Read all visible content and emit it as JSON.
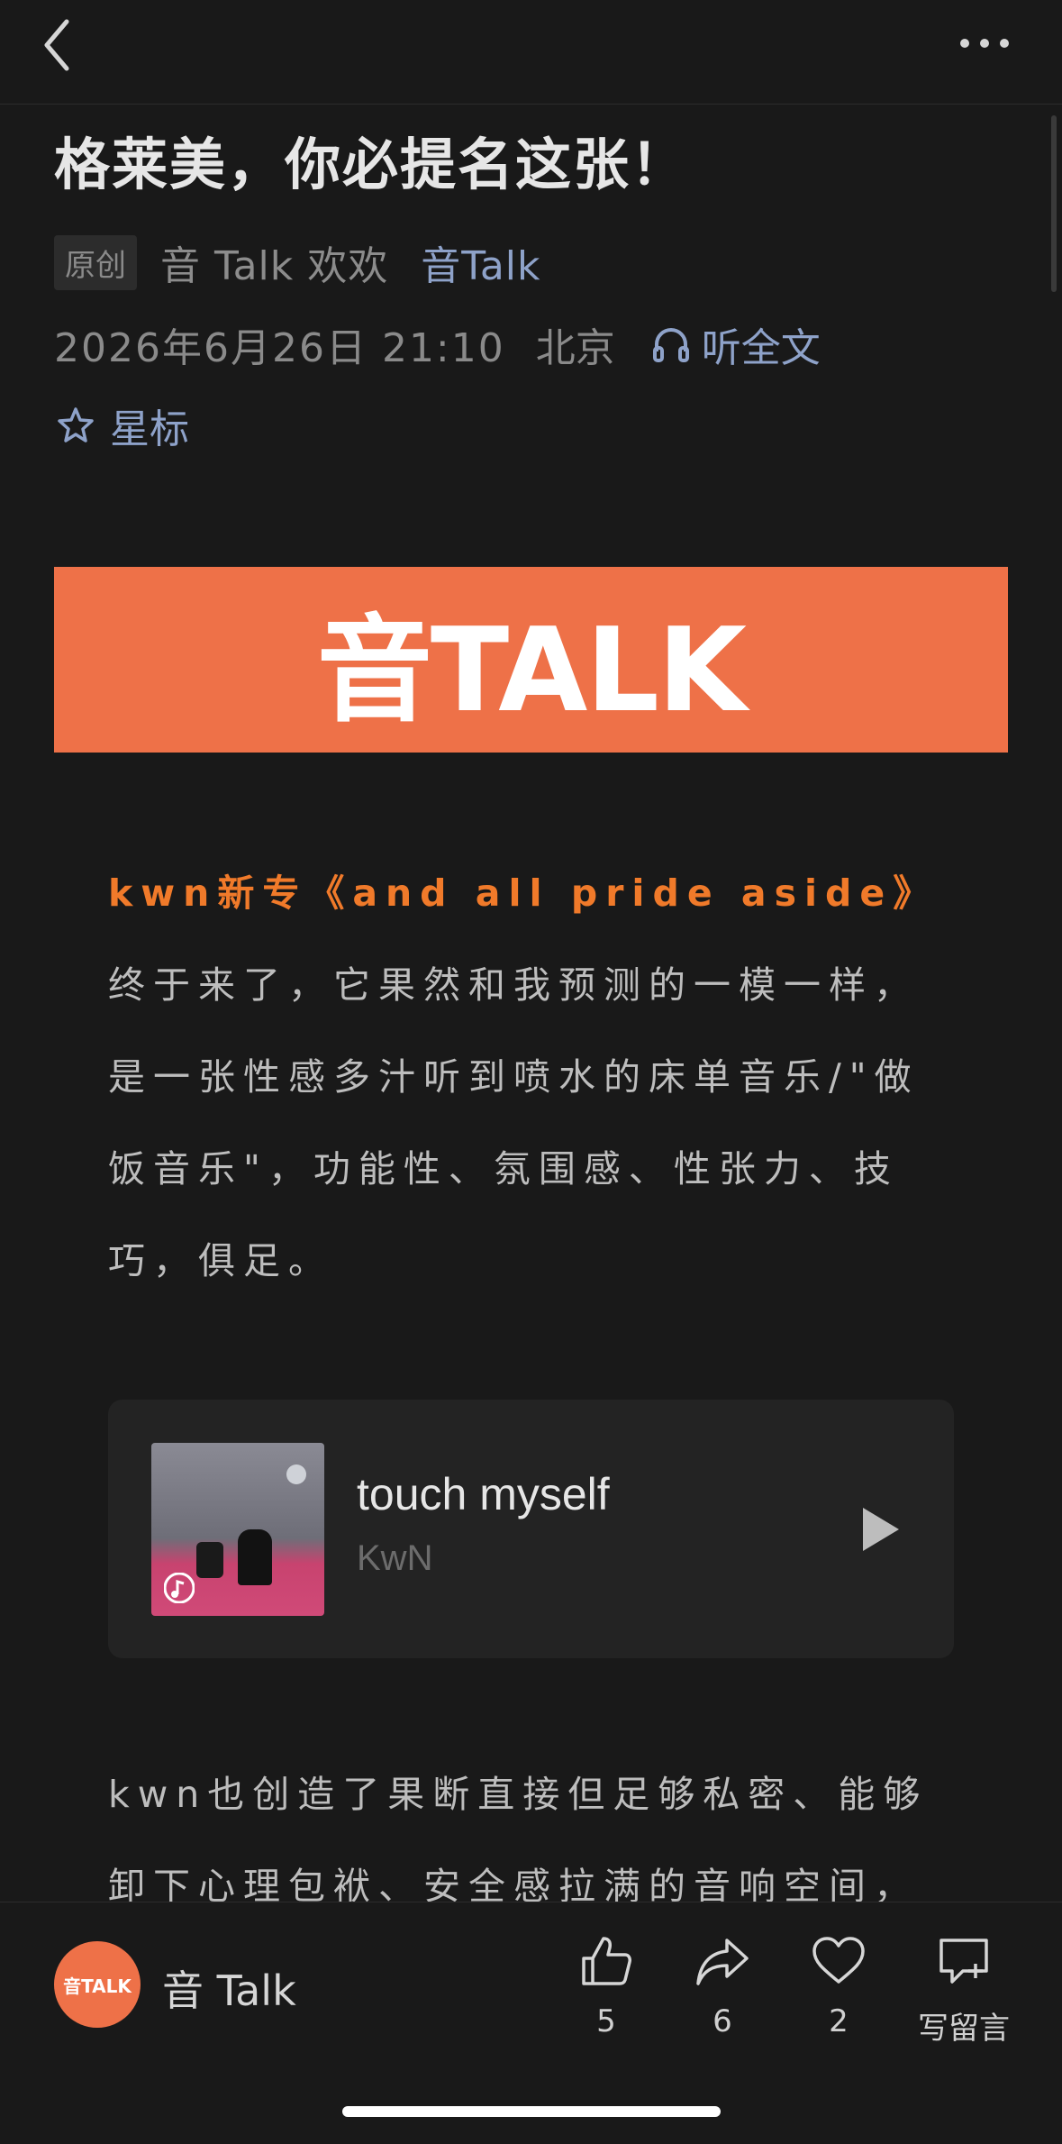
{
  "nav": {
    "back_icon": "chevron-left-icon",
    "more_icon": "ellipsis-icon"
  },
  "article": {
    "title": "格莱美，你必提名这张！",
    "original_badge": "原创",
    "author": "音 Talk 欢欢",
    "account_link": "音Talk",
    "date": "2026年6月26日 21:10",
    "location": "北京",
    "listen_label": "听全文",
    "star_label": "星标"
  },
  "banner": {
    "text": "音TALK",
    "color": "#ee7148"
  },
  "paragraph1": {
    "highlight": "kwn新专《and all pride aside》",
    "text": "终于来了，它果然和我预测的一模一样，是一张性感多汁听到喷水的床单音乐/\"做饭音乐\"，功能性、氛围感、性张力、技巧，俱足。"
  },
  "music_card": {
    "title": "touch myself",
    "artist": "KwN",
    "play_icon": "play-icon"
  },
  "paragraph2": {
    "text": "kwn也创造了果断直接但足够私密、能够卸下心理包袱、安全感拉满的音响空间，"
  },
  "bottom_bar": {
    "avatar_text": "音TALK",
    "account_name": "音 Talk",
    "like_count": "5",
    "share_count": "6",
    "favorite_count": "2",
    "comment_label": "写留言"
  },
  "colors": {
    "accent_orange": "#ee7148",
    "link_blue": "#8ea2c9",
    "highlight_orange": "#f07a2a",
    "background": "#191919"
  }
}
